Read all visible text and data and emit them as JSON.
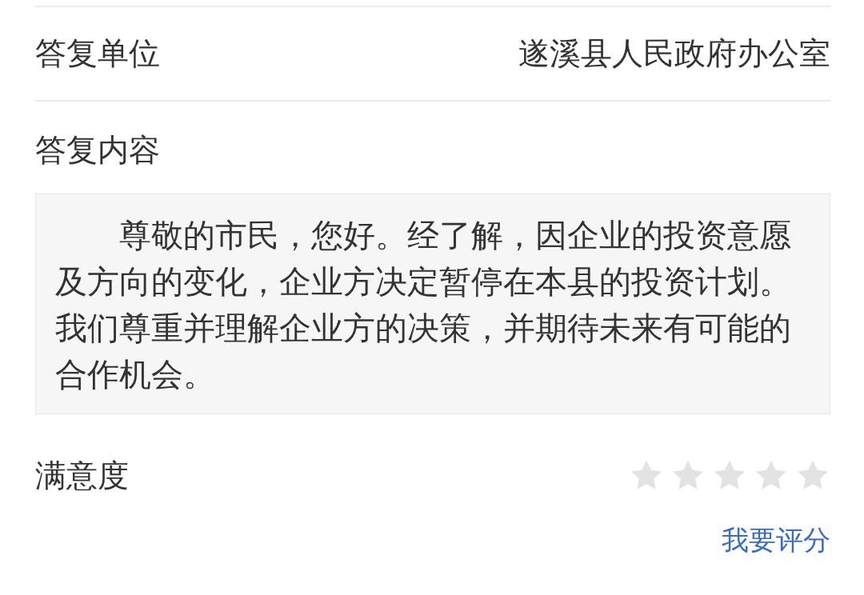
{
  "fields": [
    {
      "label": "答复单位",
      "value": "遂溪县人民政府办公室"
    }
  ],
  "reply": {
    "label": "答复内容",
    "text": "尊敬的市民，您好。经了解，因企业的投资意愿及方向的变化，企业方决定暂停在本县的投资计划。我们尊重并理解企业方的决策，并期待未来有可能的合作机会。"
  },
  "satisfaction": {
    "label": "满意度",
    "stars": 0
  },
  "rate_link": "我要评分"
}
